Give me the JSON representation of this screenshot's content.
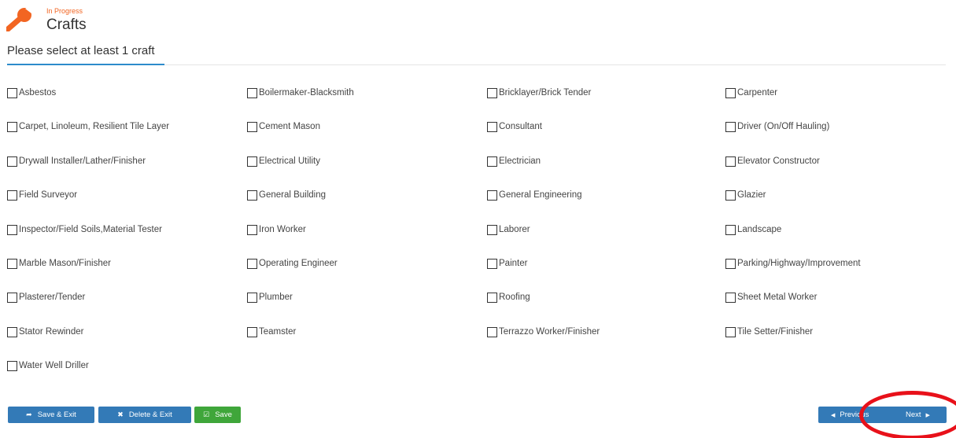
{
  "header": {
    "icon": "wrench-icon",
    "status": "In Progress",
    "title": "Crafts",
    "accent": "#f26522"
  },
  "instruction": "Please select at least 1 craft",
  "crafts": [
    [
      "Asbestos",
      "Boilermaker-Blacksmith",
      "Bricklayer/Brick Tender",
      "Carpenter"
    ],
    [
      "Carpet, Linoleum, Resilient Tile Layer",
      "Cement Mason",
      "Consultant",
      "Driver (On/Off Hauling)"
    ],
    [
      "Drywall Installer/Lather/Finisher",
      "Electrical Utility",
      "Electrician",
      "Elevator Constructor"
    ],
    [
      "Field Surveyor",
      "General Building",
      "General Engineering",
      "Glazier"
    ],
    [
      "Inspector/Field Soils,Material Tester",
      "Iron Worker",
      "Laborer",
      "Landscape"
    ],
    [
      "Marble Mason/Finisher",
      "Operating Engineer",
      "Painter",
      "Parking/Highway/Improvement"
    ],
    [
      "Plasterer/Tender",
      "Plumber",
      "Roofing",
      "Sheet Metal Worker"
    ],
    [
      "Stator Rewinder",
      "Teamster",
      "Terrazzo Worker/Finisher",
      "Tile Setter/Finisher"
    ],
    [
      "Water Well Driller"
    ]
  ],
  "footer": {
    "save_exit": "Save & Exit",
    "delete_exit": "Delete & Exit",
    "save": "Save",
    "previous": "Previous",
    "next": "Next"
  },
  "colors": {
    "primary": "#337ab7",
    "success": "#3fa63a",
    "annotation": "#e8111a"
  }
}
